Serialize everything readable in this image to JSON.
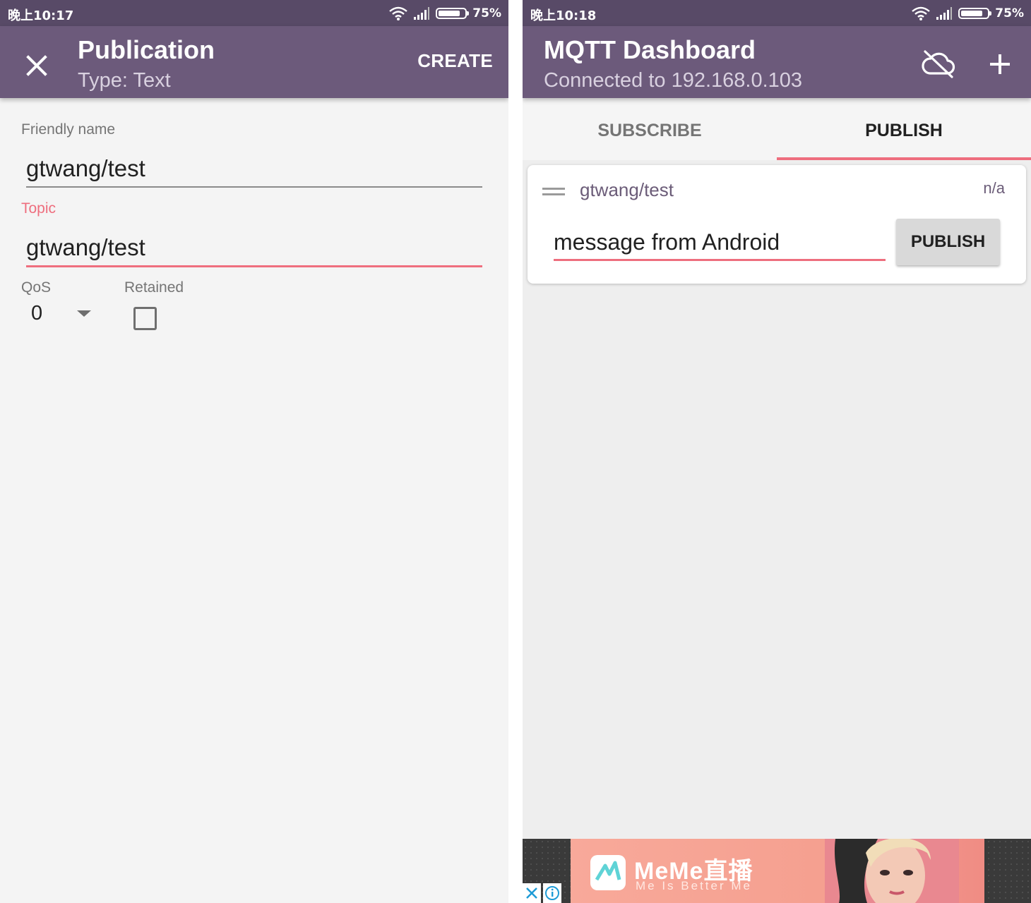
{
  "left": {
    "status": {
      "time": "晚上10:17",
      "battery_pct": "75%",
      "battery_level": 0.75
    },
    "appbar": {
      "title": "Publication",
      "subtitle": "Type: Text",
      "create_label": "CREATE",
      "close_icon": "close-icon"
    },
    "form": {
      "friendly_name": {
        "label": "Friendly name",
        "value": "gtwang/test"
      },
      "topic": {
        "label": "Topic",
        "value": "gtwang/test"
      },
      "qos": {
        "label": "QoS",
        "value": "0"
      },
      "retained": {
        "label": "Retained",
        "checked": false
      }
    }
  },
  "right": {
    "status": {
      "time": "晚上10:18",
      "battery_pct": "75%",
      "battery_level": 0.75
    },
    "appbar": {
      "title": "MQTT Dashboard",
      "subtitle": "Connected to 192.168.0.103",
      "cloud_icon": "cloud-off-icon",
      "add_icon": "add-icon"
    },
    "tabs": [
      {
        "label": "SUBSCRIBE",
        "active": false
      },
      {
        "label": "PUBLISH",
        "active": true
      }
    ],
    "card": {
      "topic": "gtwang/test",
      "meta": "n/a",
      "message_value": "message from Android",
      "publish_label": "PUBLISH"
    },
    "ad": {
      "brand": "MeMe直播",
      "tagline": "Me Is Better Me"
    }
  },
  "colors": {
    "statusbar": "#584a67",
    "appbar": "#6c5a7b",
    "accent": "#ee6e7e"
  }
}
